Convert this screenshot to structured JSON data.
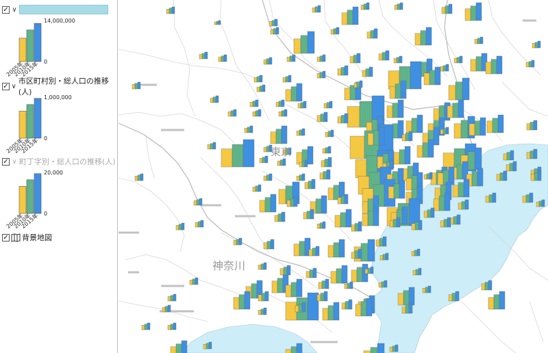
{
  "legend": {
    "layers": [
      {
        "name": "",
        "checked": true,
        "expanded": true,
        "selected": true,
        "dim": false,
        "axis_max": "14,000,000",
        "axis_min": "0",
        "years": [
          "2005年",
          "2010年",
          "2015年"
        ],
        "values": [
          0.57,
          0.77,
          0.93
        ]
      },
      {
        "name": "市区町村別・総人口の推移(人)",
        "checked": true,
        "expanded": true,
        "selected": false,
        "dim": false,
        "axis_max": "1,000,000",
        "axis_min": "0",
        "years": [
          "2005年",
          "2010年",
          "2015年"
        ],
        "values": [
          0.66,
          0.82,
          0.97
        ]
      },
      {
        "name": "町丁字別・総人口の推移(人)",
        "checked": true,
        "expanded": true,
        "selected": false,
        "dim": true,
        "axis_max": "20,000",
        "axis_min": "0",
        "years": [
          "2005年",
          "2010年",
          "2015年"
        ],
        "values": [
          0.66,
          0.82,
          0.97
        ]
      },
      {
        "name": "背景地図",
        "checked": true,
        "expanded": false,
        "selected": false,
        "dim": false,
        "icon": "map-book-icon"
      }
    ]
  },
  "map": {
    "labels": [
      {
        "text": "東京",
        "kind": "prefecture"
      },
      {
        "text": "神奈川",
        "kind": "prefecture"
      }
    ]
  },
  "colors": {
    "y2005": "#f5c841",
    "y2010": "#5fb38a",
    "y2015": "#3f8fe3",
    "sea": "#cdeef8",
    "border": "#d9d9d9",
    "selected": "#a9dbe7"
  }
}
